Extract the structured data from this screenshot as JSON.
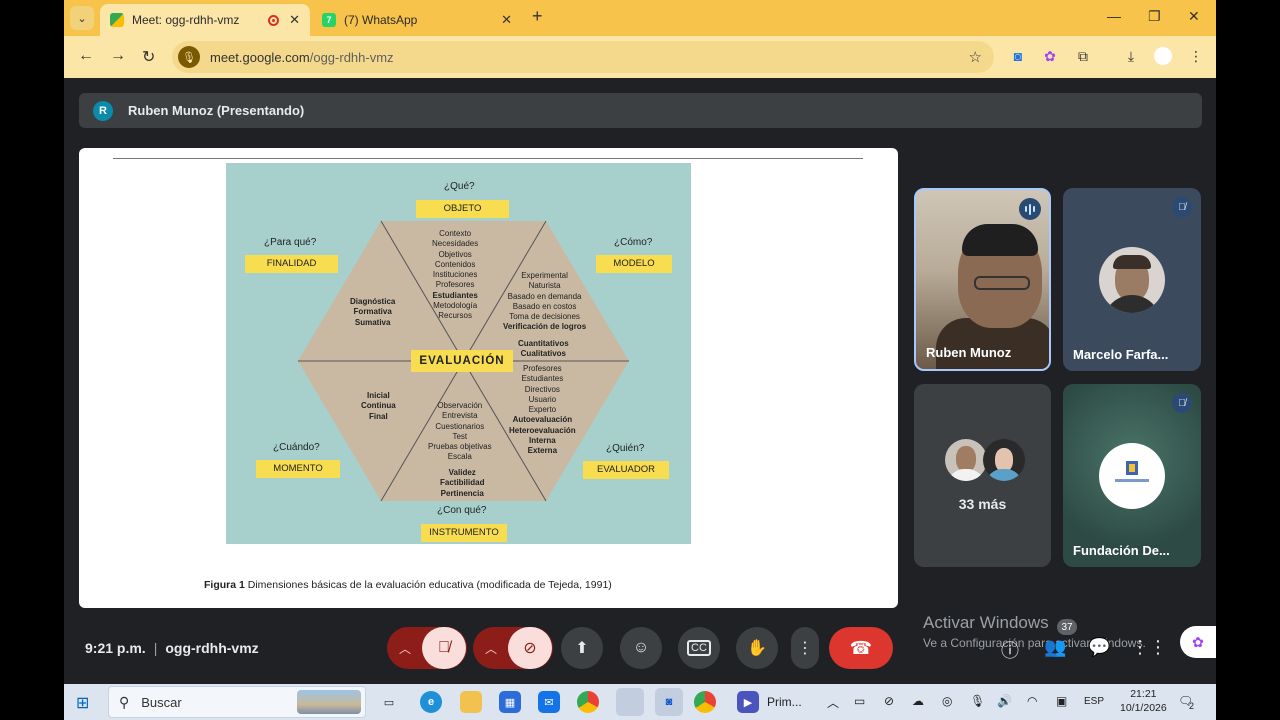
{
  "browser": {
    "tabs": [
      {
        "title": "Meet: ogg-rdhh-vmz",
        "active": true
      },
      {
        "title": "(7) WhatsApp",
        "badge": "7",
        "active": false
      }
    ],
    "url_host": "meet.google.com",
    "url_path": "/ogg-rdhh-vmz"
  },
  "meet": {
    "presenter_initial": "R",
    "presenter_label": "Ruben Munoz (Presentando)",
    "clock": "9:21 p.m.",
    "meeting_code": "ogg-rdhh-vmz",
    "participant_count": "37",
    "participants": [
      {
        "name": "Ruben Munoz",
        "speaking": true
      },
      {
        "name": "Marcelo Farfa...",
        "muted": true
      },
      {
        "name": "33 más"
      },
      {
        "name": "Fundación De...",
        "muted": true
      }
    ]
  },
  "slide": {
    "questions": {
      "que": "¿Qué?",
      "para_que": "¿Para qué?",
      "como": "¿Cómo?",
      "cuando": "¿Cuándo?",
      "quien": "¿Quién?",
      "con_que": "¿Con qué?"
    },
    "boxes": {
      "objeto": "OBJETO",
      "finalidad": "FINALIDAD",
      "modelo": "MODELO",
      "momento": "MOMENTO",
      "evaluador": "EVALUADOR",
      "instrumento": "INSTRUMENTO",
      "center": "EVALUACIÓN"
    },
    "lists": {
      "objeto": [
        "Contexto",
        "Necesidades",
        "Objetivos",
        "Contenidos",
        "Instituciones",
        "Profesores",
        "Estudiantes",
        "Metodología",
        "Recursos"
      ],
      "finalidad": [
        "Diagnóstica",
        "Formativa",
        "Sumativa"
      ],
      "modelo": [
        "Experimental",
        "Naturista",
        "Basado en demanda",
        "Basado en costos",
        "Toma de decisiones",
        "Verificación de logros"
      ],
      "cuant": [
        "Cuantitativos",
        "Cualitativos"
      ],
      "evaluador": [
        "Profesores",
        "Estudiantes",
        "Directivos",
        "Usuario",
        "Experto",
        "Autoevaluación",
        "Heteroevaluación",
        "Interna",
        "Externa"
      ],
      "momento": [
        "Inicial",
        "Continua",
        "Final"
      ],
      "instrumento": [
        "Observación",
        "Entrevista",
        "Cuestionarios",
        "Test",
        "Pruebas objetivas",
        "Escala"
      ],
      "criterios": [
        "Validez",
        "Factibilidad",
        "Pertinencia"
      ]
    },
    "caption_bold": "Figura 1",
    "caption_text": " Dimensiones básicas de la evaluación educativa (modificada de Tejeda, 1991)"
  },
  "windows_watermark": {
    "line1": "Activar Windows",
    "line2": "Ve a Configuración para activar Windows."
  },
  "taskbar": {
    "search_placeholder": "Buscar",
    "app_label": "Prim...",
    "lang": "ESP",
    "time": "21:21",
    "date": "10/1/2026",
    "notif_count": "2"
  },
  "colors": {
    "meet_bg": "#202124",
    "hangup": "#dc362e",
    "chrome_tabstrip": "#f8c34a",
    "diagram_bg": "#a7d0cc",
    "diagram_box": "#f7dd4f"
  }
}
